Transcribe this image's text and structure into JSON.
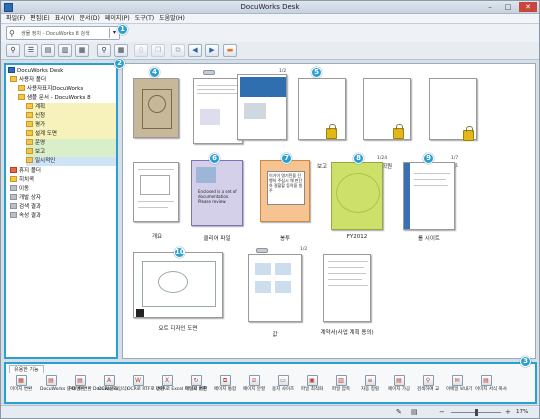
{
  "window": {
    "title": "DocuWorks Desk"
  },
  "menu": [
    "파일(F)",
    "편집(E)",
    "표시(V)",
    "문서(D)",
    "페이지(P)",
    "도구(T)",
    "도움말(H)"
  ],
  "search": {
    "text": "생물 정치 - DocuWorks 8 검색"
  },
  "callouts": [
    "1",
    "2",
    "3",
    "4",
    "5",
    "6",
    "7",
    "8",
    "9",
    "10"
  ],
  "tree": [
    "DocuWorks Desk",
    "사용자 폴더",
    "사용자표지DocuWorks",
    "샘플 문서 - DocuWorks 8",
    "계획",
    "신청",
    "평가",
    "설계 도면",
    "운영",
    "보고",
    "일시적인",
    "휴지 폴더",
    "히치콕",
    "이동",
    "개발 상자",
    "검색 결과",
    "속성 결과"
  ],
  "documents": [
    {
      "label": "요트 디자인 도면",
      "count": ""
    },
    {
      "label": "1-2",
      "count": "1/2"
    },
    {
      "label": "보고",
      "count": ""
    },
    {
      "label": "회원",
      "count": ""
    },
    {
      "label": "봉투",
      "count": ""
    },
    {
      "label": "개요",
      "count": ""
    },
    {
      "label": "클리어 파일",
      "count": ""
    },
    {
      "label": "봉투",
      "count": ""
    },
    {
      "label": "FY2012",
      "count": "1/24"
    },
    {
      "label": "롤 시이트",
      "count": "1/7"
    },
    {
      "label": "요트 디자인 도면",
      "count": ""
    },
    {
      "label": "값",
      "count": "1/2"
    },
    {
      "label": "계약서(사업 계획 용의)",
      "count": ""
    }
  ],
  "sticky_texts": {
    "memo": "이가이 명기된을 진행하 주십시 해 판단하 절할할 등락을 원주",
    "cover": "Enclosed is a set of documentation. Please review."
  },
  "bottom": {
    "tab": "유용한 기능",
    "plugins": [
      "이미지 변환",
      "DocuWorks 문서 변환",
      "PDF로 변환 DocuWorks...",
      "OCR(문자인식)",
      "OCR로 RTF로 변환",
      "OCR로 Excel 파일로 변환",
      "이미지 회전",
      "페이지 통합",
      "페이지 분할",
      "용지 사이즈",
      "파일 최적화",
      "파일 압축",
      "자동 정렬",
      "페이지 가공",
      "검색하여 교",
      "이메일 보내기",
      "이미지 서식 복사"
    ]
  },
  "status": {
    "zoom": "17%"
  }
}
